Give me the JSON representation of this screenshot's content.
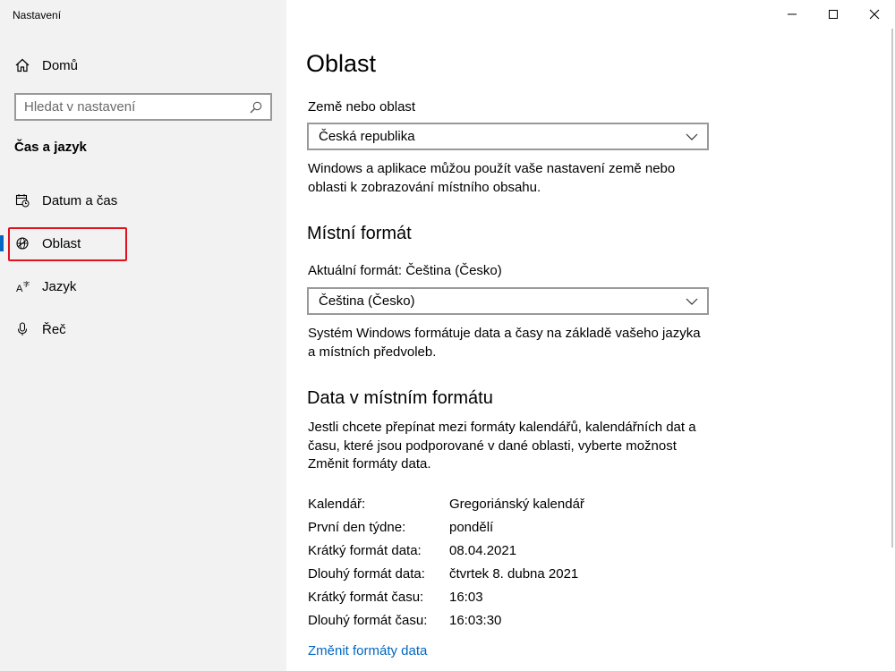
{
  "window": {
    "title": "Nastavení",
    "controls": [
      "minimize",
      "maximize",
      "close"
    ]
  },
  "sidebar": {
    "home_label": "Domů",
    "search_placeholder": "Hledat v nastavení",
    "section_title": "Čas a jazyk",
    "items": [
      {
        "label": "Datum a čas",
        "icon": "calendar-clock-icon"
      },
      {
        "label": "Oblast",
        "icon": "globe-icon",
        "selected": true
      },
      {
        "label": "Jazyk",
        "icon": "language-icon"
      },
      {
        "label": "Řeč",
        "icon": "microphone-icon"
      }
    ]
  },
  "main": {
    "title": "Oblast",
    "country": {
      "label": "Země nebo oblast",
      "value": "Česká republika",
      "description": "Windows a aplikace můžou použít vaše nastavení země nebo oblasti k zobrazování místního obsahu."
    },
    "regional_format": {
      "heading": "Místní formát",
      "label": "Aktuální formát: Čeština (Česko)",
      "value": "Čeština (Česko)",
      "description": "Systém Windows formátuje data a časy na základě vašeho jazyka a místních předvoleb."
    },
    "format_data": {
      "heading": "Data v místním formátu",
      "description": "Jestli chcete přepínat mezi formáty kalendářů, kalendářních dat a času, které jsou podporované v dané oblasti, vyberte možnost Změnit formáty data.",
      "rows": [
        {
          "key": "Kalendář:",
          "value": "Gregoriánský kalendář"
        },
        {
          "key": "První den týdne:",
          "value": "pondělí"
        },
        {
          "key": "Krátký formát data:",
          "value": "08.04.2021"
        },
        {
          "key": "Dlouhý formát data:",
          "value": "čtvrtek 8. dubna 2021"
        },
        {
          "key": "Krátký formát času:",
          "value": "16:03"
        },
        {
          "key": "Dlouhý formát času:",
          "value": "16:03:30"
        }
      ],
      "link": "Změnit formáty data"
    }
  },
  "colors": {
    "accent": "#0067c0",
    "highlight_box": "#e1111e",
    "sidebar_bg": "#f2f2f2"
  }
}
